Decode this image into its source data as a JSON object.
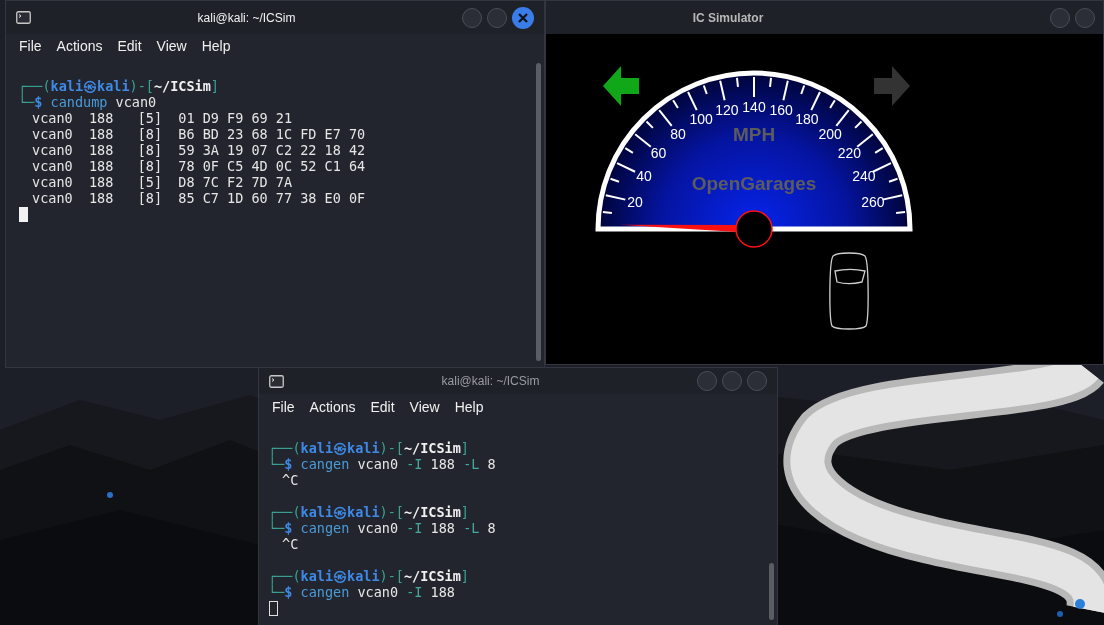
{
  "terminal_1": {
    "title": "kali@kali: ~/ICSim",
    "focused": true,
    "menu": [
      "File",
      "Actions",
      "Edit",
      "View",
      "Help"
    ],
    "lines": [
      {
        "kind": "blank"
      },
      {
        "kind": "prompt",
        "segments": [
          {
            "text": "┌──(",
            "kind": "frame"
          },
          {
            "text": "kali㉿kali",
            "kind": "user"
          },
          {
            "text": ")-[",
            "kind": "frame"
          },
          {
            "text": "~/ICSim",
            "kind": "path"
          },
          {
            "text": "]",
            "kind": "frame"
          }
        ]
      },
      {
        "kind": "command",
        "segments": [
          {
            "text": "└─",
            "kind": "frame"
          },
          {
            "text": "$ ",
            "kind": "sigil"
          },
          {
            "text": "candump",
            "kind": "command"
          },
          {
            "text": " vcan0",
            "kind": "arg"
          }
        ]
      },
      {
        "kind": "output",
        "text": "vcan0  188   [5]  01 D9 F9 69 21"
      },
      {
        "kind": "output",
        "text": "vcan0  188   [8]  B6 BD 23 68 1C FD E7 70"
      },
      {
        "kind": "output",
        "text": "vcan0  188   [8]  59 3A 19 07 C2 22 18 42"
      },
      {
        "kind": "output",
        "text": "vcan0  188   [8]  78 0F C5 4D 0C 52 C1 64"
      },
      {
        "kind": "output",
        "text": "vcan0  188   [5]  D8 7C F2 7D 7A"
      },
      {
        "kind": "output",
        "text": "vcan0  188   [8]  85 C7 1D 60 77 38 E0 0F"
      },
      {
        "kind": "cursor"
      }
    ]
  },
  "ic_simulator": {
    "title": "IC Simulator",
    "turn_signals": [
      {
        "kind": "left",
        "on": true
      },
      {
        "kind": "right",
        "on": false
      }
    ],
    "gauge": {
      "unit": "MPH",
      "brand": "OpenGarages",
      "scale_labels": [
        "20",
        "40",
        "60",
        "80",
        "100",
        "120",
        "140",
        "160",
        "180",
        "200",
        "220",
        "240",
        "260"
      ]
    }
  },
  "terminal_2": {
    "title": "kali@kali: ~/ICSim",
    "focused": false,
    "menu": [
      "File",
      "Actions",
      "Edit",
      "View",
      "Help"
    ],
    "lines": [
      {
        "kind": "blank"
      },
      {
        "kind": "prompt",
        "segments": [
          {
            "text": "┌──(",
            "kind": "frame"
          },
          {
            "text": "kali㉿kali",
            "kind": "user"
          },
          {
            "text": ")-[",
            "kind": "frame"
          },
          {
            "text": "~/ICSim",
            "kind": "path"
          },
          {
            "text": "]",
            "kind": "frame"
          }
        ]
      },
      {
        "kind": "command",
        "segments": [
          {
            "text": "└─",
            "kind": "frame"
          },
          {
            "text": "$ ",
            "kind": "sigil"
          },
          {
            "text": "cangen",
            "kind": "command"
          },
          {
            "text": " vcan0 ",
            "kind": "arg"
          },
          {
            "text": "-I",
            "kind": "option"
          },
          {
            "text": " 188 ",
            "kind": "arg"
          },
          {
            "text": "-L",
            "kind": "option"
          },
          {
            "text": " 8",
            "kind": "arg"
          }
        ]
      },
      {
        "kind": "output",
        "text": "^C"
      },
      {
        "kind": "blank"
      },
      {
        "kind": "prompt",
        "segments": [
          {
            "text": "┌──(",
            "kind": "frame"
          },
          {
            "text": "kali㉿kali",
            "kind": "user"
          },
          {
            "text": ")-[",
            "kind": "frame"
          },
          {
            "text": "~/ICSim",
            "kind": "path"
          },
          {
            "text": "]",
            "kind": "frame"
          }
        ]
      },
      {
        "kind": "command",
        "segments": [
          {
            "text": "└─",
            "kind": "frame"
          },
          {
            "text": "$ ",
            "kind": "sigil"
          },
          {
            "text": "cangen",
            "kind": "command"
          },
          {
            "text": " vcan0 ",
            "kind": "arg"
          },
          {
            "text": "-I",
            "kind": "option"
          },
          {
            "text": " 188 ",
            "kind": "arg"
          },
          {
            "text": "-L",
            "kind": "option"
          },
          {
            "text": " 8",
            "kind": "arg"
          }
        ]
      },
      {
        "kind": "output",
        "text": "^C"
      },
      {
        "kind": "blank"
      },
      {
        "kind": "prompt",
        "segments": [
          {
            "text": "┌──(",
            "kind": "frame"
          },
          {
            "text": "kali㉿kali",
            "kind": "user"
          },
          {
            "text": ")-[",
            "kind": "frame"
          },
          {
            "text": "~/ICSim",
            "kind": "path"
          },
          {
            "text": "]",
            "kind": "frame"
          }
        ]
      },
      {
        "kind": "command",
        "segments": [
          {
            "text": "└─",
            "kind": "frame"
          },
          {
            "text": "$ ",
            "kind": "sigil"
          },
          {
            "text": "cangen",
            "kind": "command"
          },
          {
            "text": " vcan0 ",
            "kind": "arg"
          },
          {
            "text": "-I",
            "kind": "option"
          },
          {
            "text": " 188",
            "kind": "arg"
          }
        ]
      },
      {
        "kind": "cursor"
      }
    ]
  }
}
